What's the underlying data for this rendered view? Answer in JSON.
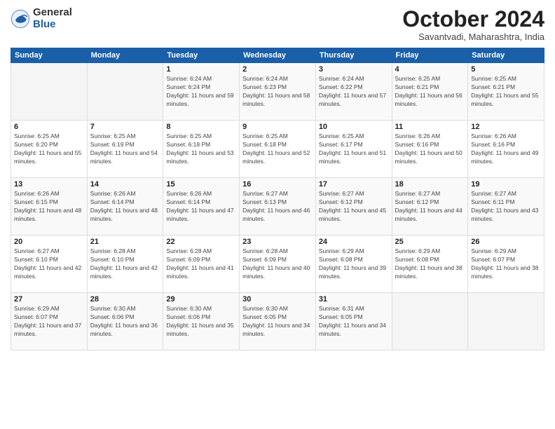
{
  "logo": {
    "general": "General",
    "blue": "Blue"
  },
  "title": "October 2024",
  "subtitle": "Savantvadi, Maharashtra, India",
  "days_header": [
    "Sunday",
    "Monday",
    "Tuesday",
    "Wednesday",
    "Thursday",
    "Friday",
    "Saturday"
  ],
  "weeks": [
    [
      {
        "day": "",
        "info": ""
      },
      {
        "day": "",
        "info": ""
      },
      {
        "day": "1",
        "info": "Sunrise: 6:24 AM\nSunset: 6:24 PM\nDaylight: 11 hours and 59 minutes."
      },
      {
        "day": "2",
        "info": "Sunrise: 6:24 AM\nSunset: 6:23 PM\nDaylight: 11 hours and 58 minutes."
      },
      {
        "day": "3",
        "info": "Sunrise: 6:24 AM\nSunset: 6:22 PM\nDaylight: 11 hours and 57 minutes."
      },
      {
        "day": "4",
        "info": "Sunrise: 6:25 AM\nSunset: 6:21 PM\nDaylight: 11 hours and 56 minutes."
      },
      {
        "day": "5",
        "info": "Sunrise: 6:25 AM\nSunset: 6:21 PM\nDaylight: 11 hours and 55 minutes."
      }
    ],
    [
      {
        "day": "6",
        "info": "Sunrise: 6:25 AM\nSunset: 6:20 PM\nDaylight: 11 hours and 55 minutes."
      },
      {
        "day": "7",
        "info": "Sunrise: 6:25 AM\nSunset: 6:19 PM\nDaylight: 11 hours and 54 minutes."
      },
      {
        "day": "8",
        "info": "Sunrise: 6:25 AM\nSunset: 6:18 PM\nDaylight: 11 hours and 53 minutes."
      },
      {
        "day": "9",
        "info": "Sunrise: 6:25 AM\nSunset: 6:18 PM\nDaylight: 11 hours and 52 minutes."
      },
      {
        "day": "10",
        "info": "Sunrise: 6:25 AM\nSunset: 6:17 PM\nDaylight: 11 hours and 51 minutes."
      },
      {
        "day": "11",
        "info": "Sunrise: 6:26 AM\nSunset: 6:16 PM\nDaylight: 11 hours and 50 minutes."
      },
      {
        "day": "12",
        "info": "Sunrise: 6:26 AM\nSunset: 6:16 PM\nDaylight: 11 hours and 49 minutes."
      }
    ],
    [
      {
        "day": "13",
        "info": "Sunrise: 6:26 AM\nSunset: 6:15 PM\nDaylight: 11 hours and 48 minutes."
      },
      {
        "day": "14",
        "info": "Sunrise: 6:26 AM\nSunset: 6:14 PM\nDaylight: 11 hours and 48 minutes."
      },
      {
        "day": "15",
        "info": "Sunrise: 6:26 AM\nSunset: 6:14 PM\nDaylight: 11 hours and 47 minutes."
      },
      {
        "day": "16",
        "info": "Sunrise: 6:27 AM\nSunset: 6:13 PM\nDaylight: 11 hours and 46 minutes."
      },
      {
        "day": "17",
        "info": "Sunrise: 6:27 AM\nSunset: 6:12 PM\nDaylight: 11 hours and 45 minutes."
      },
      {
        "day": "18",
        "info": "Sunrise: 6:27 AM\nSunset: 6:12 PM\nDaylight: 11 hours and 44 minutes."
      },
      {
        "day": "19",
        "info": "Sunrise: 6:27 AM\nSunset: 6:11 PM\nDaylight: 11 hours and 43 minutes."
      }
    ],
    [
      {
        "day": "20",
        "info": "Sunrise: 6:27 AM\nSunset: 6:10 PM\nDaylight: 11 hours and 42 minutes."
      },
      {
        "day": "21",
        "info": "Sunrise: 6:28 AM\nSunset: 6:10 PM\nDaylight: 11 hours and 42 minutes."
      },
      {
        "day": "22",
        "info": "Sunrise: 6:28 AM\nSunset: 6:09 PM\nDaylight: 11 hours and 41 minutes."
      },
      {
        "day": "23",
        "info": "Sunrise: 6:28 AM\nSunset: 6:09 PM\nDaylight: 11 hours and 40 minutes."
      },
      {
        "day": "24",
        "info": "Sunrise: 6:29 AM\nSunset: 6:08 PM\nDaylight: 11 hours and 39 minutes."
      },
      {
        "day": "25",
        "info": "Sunrise: 6:29 AM\nSunset: 6:08 PM\nDaylight: 11 hours and 38 minutes."
      },
      {
        "day": "26",
        "info": "Sunrise: 6:29 AM\nSunset: 6:07 PM\nDaylight: 11 hours and 38 minutes."
      }
    ],
    [
      {
        "day": "27",
        "info": "Sunrise: 6:29 AM\nSunset: 6:07 PM\nDaylight: 11 hours and 37 minutes."
      },
      {
        "day": "28",
        "info": "Sunrise: 6:30 AM\nSunset: 6:06 PM\nDaylight: 11 hours and 36 minutes."
      },
      {
        "day": "29",
        "info": "Sunrise: 6:30 AM\nSunset: 6:06 PM\nDaylight: 11 hours and 35 minutes."
      },
      {
        "day": "30",
        "info": "Sunrise: 6:30 AM\nSunset: 6:05 PM\nDaylight: 11 hours and 34 minutes."
      },
      {
        "day": "31",
        "info": "Sunrise: 6:31 AM\nSunset: 6:05 PM\nDaylight: 11 hours and 34 minutes."
      },
      {
        "day": "",
        "info": ""
      },
      {
        "day": "",
        "info": ""
      }
    ]
  ]
}
